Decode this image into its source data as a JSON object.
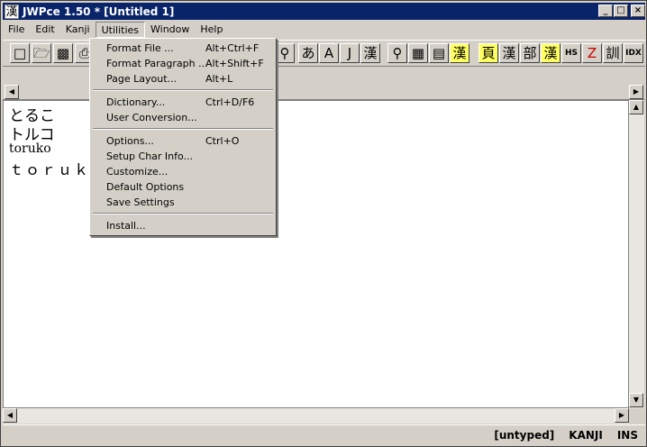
{
  "window": {
    "title": "JWPce 1.50 * [Untitled 1]",
    "app_icon_glyph": "漢"
  },
  "menubar": {
    "items": [
      "File",
      "Edit",
      "Kanji",
      "Utilities",
      "Window",
      "Help"
    ],
    "active": "Utilities"
  },
  "toolbar": {
    "kana_kanji_buttons": [
      "あ",
      "A",
      "J",
      "漢"
    ],
    "dict_buttons": [
      "頁",
      "漢",
      "部",
      "漢",
      "HS",
      "Z",
      "訓",
      "IDX"
    ]
  },
  "editor": {
    "lines": [
      "とるこ",
      "トルコ",
      "toruko",
      "ｔｏｒｕｋｏ"
    ]
  },
  "statusbar": {
    "mode": "[untyped]",
    "input": "KANJI",
    "insert": "INS"
  },
  "utilities_menu": {
    "groups": [
      [
        {
          "label": "Format File ...",
          "shortcut": "Alt+Ctrl+F"
        },
        {
          "label": "Format Paragraph ...",
          "shortcut": "Alt+Shift+F"
        },
        {
          "label": "Page Layout...",
          "shortcut": "Alt+L"
        }
      ],
      [
        {
          "label": "Dictionary...",
          "shortcut": "Ctrl+D/F6"
        },
        {
          "label": "User Conversion...",
          "shortcut": ""
        }
      ],
      [
        {
          "label": "Options...",
          "shortcut": "Ctrl+O"
        },
        {
          "label": "Setup Char Info...",
          "shortcut": ""
        },
        {
          "label": "Customize...",
          "shortcut": ""
        },
        {
          "label": "Default Options",
          "shortcut": ""
        },
        {
          "label": "Save Settings",
          "shortcut": ""
        }
      ],
      [
        {
          "label": "Install...",
          "shortcut": ""
        }
      ]
    ]
  }
}
